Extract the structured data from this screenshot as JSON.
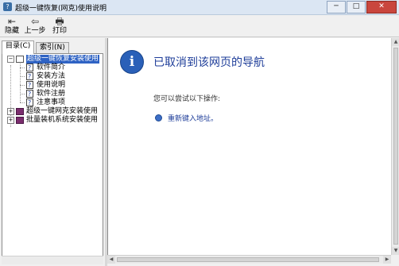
{
  "window": {
    "title": "超级一键恢复(网克)使用说明",
    "app_icon": "help-book-icon",
    "minimize": "─",
    "maximize": "□",
    "close": "✕"
  },
  "toolbar": {
    "hide_label": "隐藏",
    "back_label": "上一步",
    "print_label": "打印"
  },
  "tabs": {
    "contents": "目录(C)",
    "index": "索引(N)"
  },
  "tree": {
    "root": {
      "label": "超级一键恢复安装使用",
      "expander": "−"
    },
    "children": [
      "软件简介",
      "安装方法",
      "使用说明",
      "软件注册",
      "注意事项"
    ],
    "siblings": [
      {
        "label": "超级一键网克安装使用",
        "expander": "+"
      },
      {
        "label": "批量装机系统安装使用",
        "expander": "+"
      }
    ]
  },
  "content": {
    "icon": "info-icon",
    "heading": "已取消到该网页的导航",
    "subtext": "您可以尝试以下操作:",
    "bullet": "重新键入地址。"
  }
}
